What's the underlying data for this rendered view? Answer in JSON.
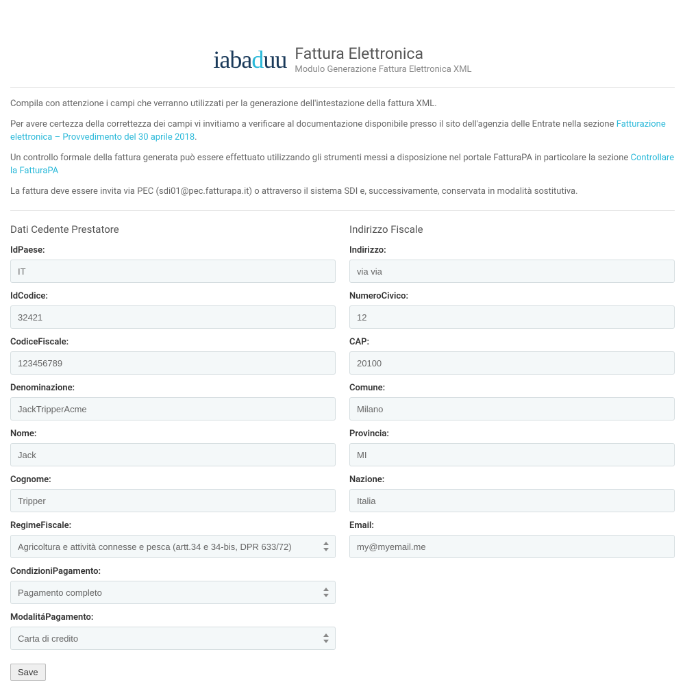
{
  "header": {
    "logo_text": "iabaduu",
    "title": "Fattura Elettronica",
    "subtitle": "Modulo Generazione Fattura Elettronica XML"
  },
  "intro": {
    "p1": "Compila con attenzione i campi che verranno utilizzati per la generazione dell'intestazione della fattura XML.",
    "p2_a": "Per avere certezza della correttezza dei campi vi invitiamo a verificare al documentazione disponibile presso il sito dell'agenzia delle Entrate nella sezione ",
    "p2_link": "Fatturazione elettronica – Provvedimento del 30 aprile 2018",
    "p2_b": ".",
    "p3_a": "Un controllo formale della fattura generata può essere effettuato utilizzando gli strumenti messi a disposizione nel portale FatturaPA in particolare la sezione ",
    "p3_link": "Controllare la FatturaPA",
    "p4": "La fattura deve essere invita via PEC (sdi01@pec.fatturapa.it) o attraverso il sistema SDI e, successivamente, conservata in modalità sostitutiva."
  },
  "left": {
    "section_title": "Dati Cedente Prestatore",
    "idpaese_label": "IdPaese:",
    "idpaese_value": "IT",
    "idcodice_label": "IdCodice:",
    "idcodice_value": "32421",
    "codicefiscale_label": "CodiceFiscale:",
    "codicefiscale_value": "123456789",
    "denominazione_label": "Denominazione:",
    "denominazione_value": "JackTripperAcme",
    "nome_label": "Nome:",
    "nome_value": "Jack",
    "cognome_label": "Cognome:",
    "cognome_value": "Tripper",
    "regimefiscale_label": "RegimeFiscale:",
    "regimefiscale_value": "Agricoltura e attività connesse e pesca (artt.34 e 34-bis, DPR 633/72)",
    "condizionipagamento_label": "CondizioniPagamento:",
    "condizionipagamento_value": "Pagamento completo",
    "modalitapagamento_label": "ModalitáPagamento:",
    "modalitapagamento_value": "Carta di credito"
  },
  "right": {
    "section_title": "Indirizzo Fiscale",
    "indirizzo_label": "Indirizzo:",
    "indirizzo_value": "via via",
    "numerocivico_label": "NumeroCivico:",
    "numerocivico_value": "12",
    "cap_label": "CAP:",
    "cap_value": "20100",
    "comune_label": "Comune:",
    "comune_value": "Milano",
    "provincia_label": "Provincia:",
    "provincia_value": "MI",
    "nazione_label": "Nazione:",
    "nazione_value": "Italia",
    "email_label": "Email:",
    "email_value": "my@myemail.me"
  },
  "actions": {
    "save_label": "Save"
  }
}
